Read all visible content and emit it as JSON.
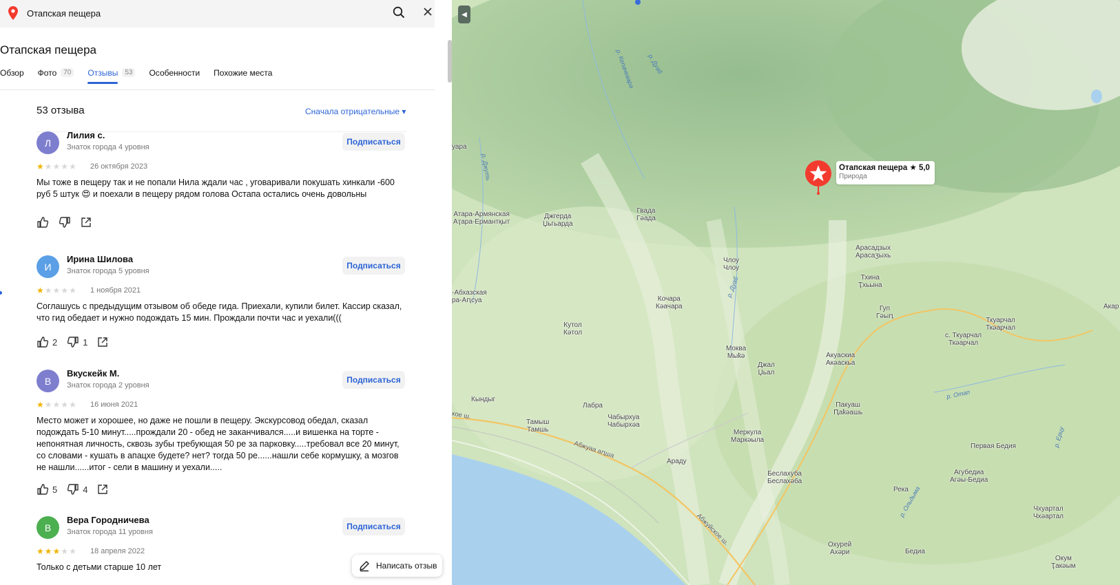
{
  "search": {
    "query": "Отапская пещера"
  },
  "place": {
    "title": "Отапская пещера"
  },
  "tabs": [
    {
      "label": "Обзор",
      "count": ""
    },
    {
      "label": "Фото",
      "count": "70"
    },
    {
      "label": "Отзывы",
      "count": "53"
    },
    {
      "label": "Особенности",
      "count": ""
    },
    {
      "label": "Похожие места",
      "count": ""
    }
  ],
  "reviews_header": {
    "title": "53 отзыва",
    "sort": "Сначала отрицательные ▾"
  },
  "subscribe_label": "Подписаться",
  "reviews": [
    {
      "initial": "Л",
      "avatar_color": "#7e7ecf",
      "author": "Лилия с.",
      "level": "Знаток города 4 уровня",
      "rating": 1,
      "date": "26 октября 2023",
      "text": "Мы тоже в пещеру так и не попали Нила ждали час , уговаривали покушать хинкали -600 руб 5 штук 😍  и поехали в пещеру рядом голова Остапа остались очень довольны",
      "likes": "",
      "dislikes": ""
    },
    {
      "initial": "И",
      "avatar_color": "#5b9fe6",
      "author": "Ирина Шилова",
      "level": "Знаток города 5 уровня",
      "rating": 1,
      "date": "1 ноября 2021",
      "text": "Соглашусь с предыдущим отзывом об обеде гида. Приехали, купили билет. Кассир сказал, что гид обедает и нужно подождать 15 мин. Прождали почти час и уехали(((",
      "likes": "2",
      "dislikes": "1"
    },
    {
      "initial": "В",
      "avatar_color": "#7e7ecf",
      "author": "Вкускейк М.",
      "level": "Знаток города 2 уровня",
      "rating": 1,
      "date": "16 июня 2021",
      "text": "Место может и хорошее, но даже не пошли в пещеру. Экскурсовод обедал, сказал подождать 5-10 минут.....прождали 20 - обед не заканчивался.....и вишенка на торте - непонятная личность, сквозь зубы требующая 50 ре за парковку.....требовал все 20 минут, со словами - кушать в апацхе будете? нет? тогда 50 ре......нашли себе кормушку, а мозгов не нашли......итог - сели в машину и уехали.....",
      "likes": "5",
      "dislikes": "4"
    },
    {
      "initial": "В",
      "avatar_color": "#4caf50",
      "author": "Вера Городничева",
      "level": "Знаток города 11 уровня",
      "rating": 3,
      "date": "18 апреля 2022",
      "text": "Только с детьми старше 10 лет",
      "likes": "",
      "dislikes": ""
    }
  ],
  "write_review": "Написать отзыв",
  "map": {
    "poi": {
      "name": "Отапская пещера",
      "rating": "★ 5,0",
      "category": "Природа"
    },
    "labels": [
      [
        "Атара-Армянская",
        "Аҭара-Ермантқыт"
      ],
      [
        "Джгерда",
        "Џьгьарда"
      ],
      [
        "Гвада",
        "Гәада"
      ],
      [
        "Члоу",
        "Члоу"
      ],
      [
        "Арасадзых",
        "Арасаӡыхь"
      ],
      [
        "Тхина",
        "Ҭхьына"
      ],
      [
        "Гуп",
        "Гәыԥ"
      ],
      [
        "Ткуарчал",
        "Ткәарчал"
      ],
      [
        "с. Ткуарчал",
        "Ткәарчал"
      ],
      [
        "-Абхазская",
        "ра-Аԥсуа"
      ],
      [
        "Кочара",
        "Кәачара"
      ],
      [
        "Кутол",
        "Кәтол"
      ],
      [
        "Моква",
        "Мыҟә"
      ],
      [
        "Джал",
        "Џьал"
      ],
      [
        "Акуаскиа",
        "Акәаскьа"
      ],
      [
        "Кындыг",
        ""
      ],
      [
        "Лабра",
        ""
      ],
      [
        "Тамыш",
        "Тамшь"
      ],
      [
        "Чабырхуа",
        "Чабырхәа"
      ],
      [
        "Пакуаш",
        "Ԥаҟәашь"
      ],
      [
        "Меркула",
        "Маркәыла"
      ],
      [
        "Араду",
        ""
      ],
      [
        "Беслахуба",
        "Беслахәба"
      ],
      [
        "Первая Бедия",
        ""
      ],
      [
        "Агубедиа",
        "Агәы-Бедиа"
      ],
      [
        "Река",
        ""
      ],
      [
        "Чхуартал",
        "Чхәартал"
      ],
      [
        "Охурей",
        "Ахәри"
      ],
      [
        "Бедиа",
        ""
      ],
      [
        "Окум",
        "Ҭакәым"
      ],
      [
        "уара",
        ""
      ],
      [
        "Акар",
        ""
      ]
    ],
    "rivers": [
      "р. Кепачевара",
      "р. Дуаб",
      "р. Джуть",
      "р. Дуаб",
      "р. Отап",
      "р. Ольдыма",
      "р. Ерцу"
    ],
    "roads": [
      "Абжуаа аԥша",
      "Абжуйское ш.",
      "кое ш."
    ]
  }
}
